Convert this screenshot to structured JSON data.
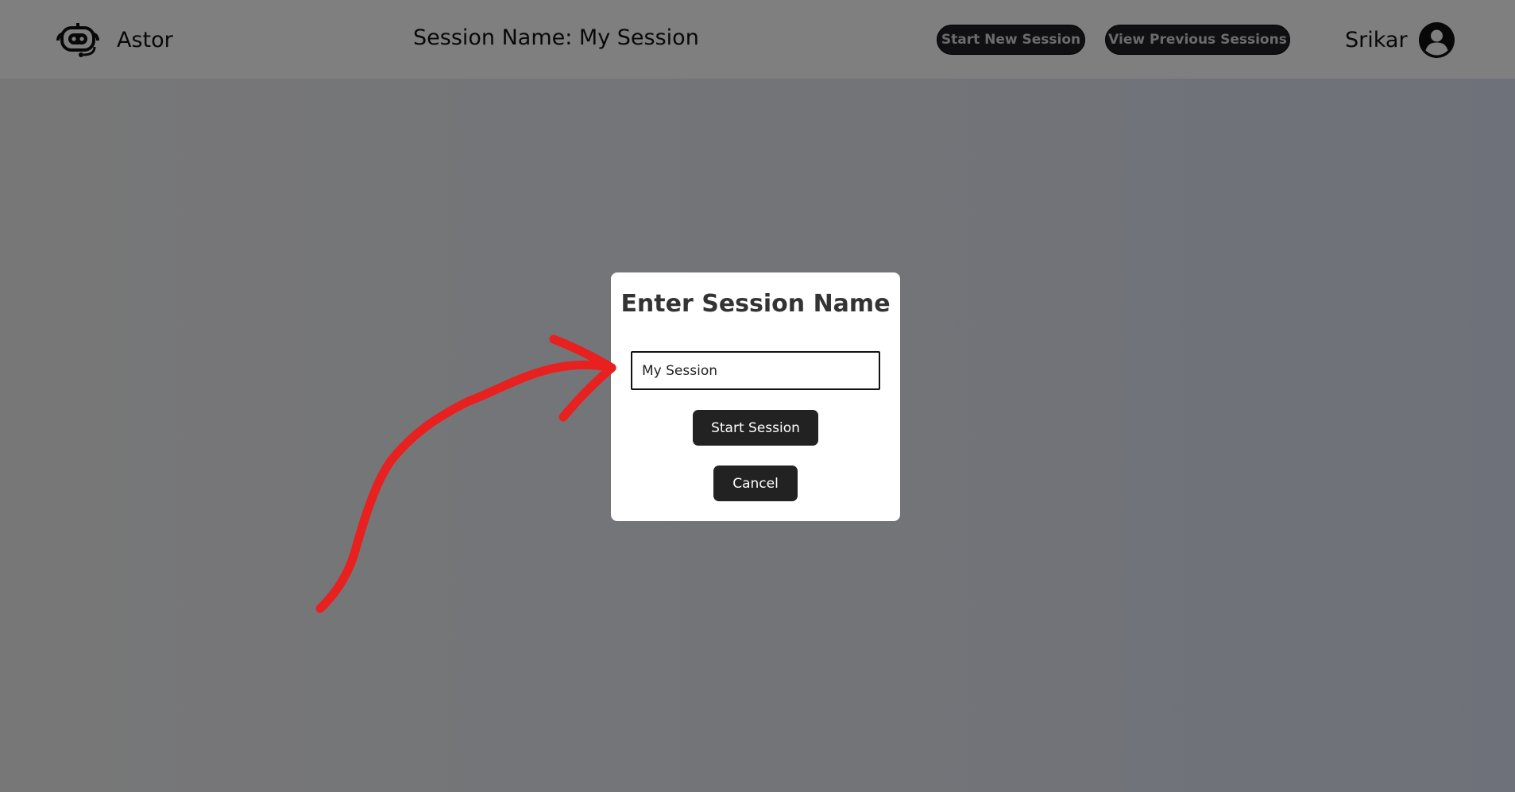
{
  "header": {
    "brand_name": "Astor",
    "brand_icon": "robot-headset-icon",
    "session_title": "Session Name: My Session",
    "start_new_session_label": "Start New Session",
    "view_previous_sessions_label": "View Previous Sessions",
    "user_name": "Srikar",
    "avatar_icon": "user-circle-icon"
  },
  "modal": {
    "title": "Enter Session Name",
    "input_value": "My Session",
    "start_button_label": "Start Session",
    "cancel_button_label": "Cancel"
  },
  "annotation": {
    "type": "hand-drawn-arrow",
    "color": "#e8201f"
  }
}
